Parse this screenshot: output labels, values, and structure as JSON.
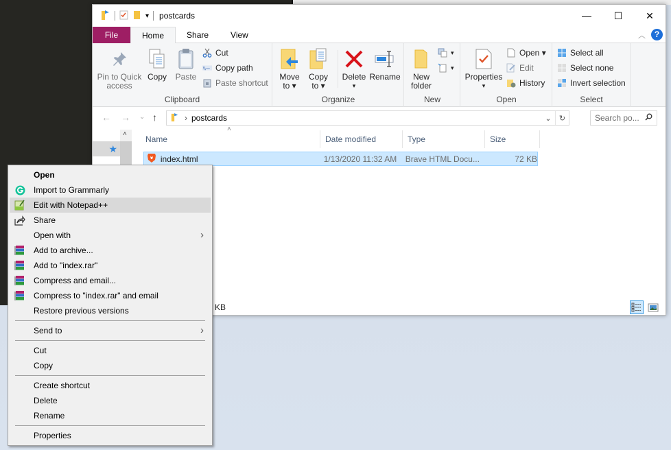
{
  "window": {
    "title": "postcards",
    "controls": {
      "minimize": "—",
      "maximize": "☐",
      "close": "✕"
    }
  },
  "ribbon_tabs": [
    {
      "label": "File"
    },
    {
      "label": "Home",
      "active": true
    },
    {
      "label": "Share"
    },
    {
      "label": "View"
    }
  ],
  "ribbon": {
    "clipboard": {
      "label": "Clipboard",
      "pin": "Pin to Quick access",
      "pin_line1": "Pin to Quick",
      "pin_line2": "access",
      "copy": "Copy",
      "paste": "Paste",
      "cut": "Cut",
      "copy_path": "Copy path",
      "paste_shortcut": "Paste shortcut"
    },
    "organize": {
      "label": "Organize",
      "move_line1": "Move",
      "move_line2": "to ▾",
      "copy_line1": "Copy",
      "copy_line2": "to ▾",
      "delete": "Delete",
      "delete_arrow": "▾",
      "rename": "Rename"
    },
    "new": {
      "label": "New",
      "new_folder_line1": "New",
      "new_folder_line2": "folder",
      "new_item_arrow": "▾",
      "easy_access_arrow": "▾"
    },
    "open": {
      "label": "Open",
      "properties": "Properties",
      "properties_arrow": "▾",
      "open": "Open ▾",
      "edit": "Edit",
      "history": "History"
    },
    "select": {
      "label": "Select",
      "select_all": "Select all",
      "select_none": "Select none",
      "invert": "Invert selection"
    }
  },
  "nav": {
    "back": "←",
    "forward": "→",
    "recent": "⌄",
    "up": "↑",
    "breadcrumb_sep": "›",
    "path": "postcards",
    "search_placeholder": "Search po..."
  },
  "columns": [
    {
      "label": "Name"
    },
    {
      "label": "Date modified"
    },
    {
      "label": "Type"
    },
    {
      "label": "Size"
    }
  ],
  "files": [
    {
      "name": "index.html",
      "date": "1/13/2020 11:32 AM",
      "type": "Brave HTML Docu...",
      "size": "72 KB",
      "selected": true
    }
  ],
  "status": {
    "text": "KB"
  },
  "context_menu": {
    "items": [
      {
        "label": "Open",
        "bold": true
      },
      {
        "label": "Import to Grammarly",
        "icon": "grammarly"
      },
      {
        "label": "Edit with Notepad++",
        "icon": "notepadpp",
        "hover": true
      },
      {
        "label": "Share",
        "icon": "share"
      },
      {
        "label": "Open with",
        "submenu": true
      },
      {
        "label": "Add to archive...",
        "icon": "winrar"
      },
      {
        "label": "Add to \"index.rar\"",
        "icon": "winrar"
      },
      {
        "label": "Compress and email...",
        "icon": "winrar"
      },
      {
        "label": "Compress to \"index.rar\" and email",
        "icon": "winrar"
      },
      {
        "label": "Restore previous versions"
      },
      {
        "separator": true
      },
      {
        "label": "Send to",
        "submenu": true
      },
      {
        "separator": true
      },
      {
        "label": "Cut"
      },
      {
        "label": "Copy"
      },
      {
        "separator": true
      },
      {
        "label": "Create shortcut"
      },
      {
        "label": "Delete"
      },
      {
        "label": "Rename"
      },
      {
        "separator": true
      },
      {
        "label": "Properties"
      }
    ],
    "submenu_arrow": "›"
  },
  "colors": {
    "file_tab": "#9e1e64",
    "selection": "#cce8ff",
    "selection_border": "#99d1ff",
    "menu_bg": "#f0f0f0",
    "menu_hover": "#d9d9d9"
  }
}
